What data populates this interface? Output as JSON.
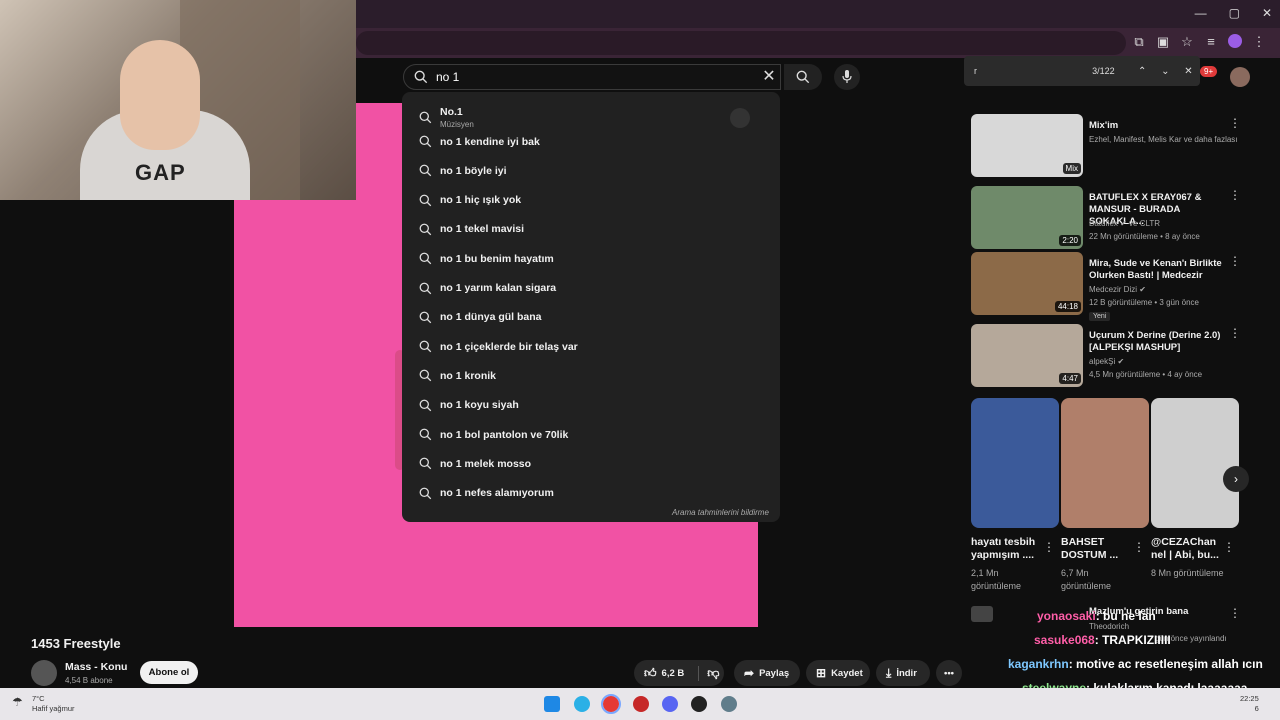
{
  "colors": {
    "accent": "#f152a4",
    "chat_user_1": "#ff5ea8",
    "chat_user_2": "#ff5ea8",
    "chat_user_3": "#7ec8ff",
    "chat_user_4": "#8ee88e"
  },
  "search": {
    "query": "no 1",
    "first_suggestion": {
      "title": "No.1",
      "subtitle": "Müzisyen"
    },
    "suggestions": [
      "no 1 kendine iyi bak",
      "no 1 böyle iyi",
      "no 1 hiç ışık yok",
      "no 1 tekel mavisi",
      "no 1 bu benim hayatım",
      "no 1 yarım kalan sigara",
      "no 1 dünya gül bana",
      "no 1 çiçeklerde bir telaş var",
      "no 1 kronik",
      "no 1 koyu siyah",
      "no 1 bol pantolon ve 70lik",
      "no 1 melek mosso",
      "no 1 nefes alamıyorum"
    ],
    "report_label": "Arama tahminlerini bildirme"
  },
  "findbar": {
    "query": "r",
    "count": "3/122"
  },
  "notifications": "9+",
  "webcam": {
    "shirt_text": "GAP"
  },
  "related": [
    {
      "title": "Mix'im",
      "line1": "Ezhel, Manifest, Melis Kar ve daha fazlası",
      "line2": "",
      "duration": "Mix",
      "thumb": "#d8d8d8"
    },
    {
      "title": "BATUFLEX X ERAY067 & MANSUR - BURADA SOKAKLA...",
      "line1": "Batuflex ✔ ve CLTR",
      "line2": "22 Mn görüntüleme • 8 ay önce",
      "duration": "2:20",
      "thumb": "#6f8a6a"
    },
    {
      "title": "Mira, Sude ve Kenan'ı Birlikte Olurken Bastı! | Medcezir",
      "line1": "Medcezir Dizi ✔",
      "line2": "12 B görüntüleme • 3 gün önce",
      "badge": "Yeni",
      "duration": "44:18",
      "thumb": "#8c6a48"
    },
    {
      "title": "Uçurum X Derine (Derine 2.0) [ALPEKŞI MASHUP]",
      "line1": "alpekŞi ✔",
      "line2": "4,5 Mn görüntüleme • 4 ay önce",
      "duration": "4:47",
      "thumb": "#b5a89a"
    }
  ],
  "shorts": [
    {
      "title": "hayatı tesbih yapmışım ....",
      "views": "2,1 Mn görüntüleme",
      "thumb": "#3b5a9a"
    },
    {
      "title": "BAHSET DOSTUM ...",
      "views": "6,7 Mn görüntüleme",
      "thumb": "#b07f6a"
    },
    {
      "title": "@CEZAChan nel | Abi, bu...",
      "views": "8 Mn görüntüleme",
      "thumb": "#cfcfcf"
    }
  ],
  "next_item": {
    "title": "Mazlum'u getirin bana",
    "channel": "Theodorich",
    "meta": "gün önce yayınlandı"
  },
  "video": {
    "title": "1453 Freestyle",
    "channel": "Mass - Konu",
    "subs": "4,54 B abone",
    "subscribe": "Abone ol",
    "likes": "6,2 B",
    "share": "Paylaş",
    "save": "Kaydet",
    "download": "İndir"
  },
  "chat": [
    {
      "user": "yonaosaki",
      "msg": ": bu ne lan"
    },
    {
      "user": "sasuke068",
      "msg": ": TRAPKIZIIIII"
    },
    {
      "user": "kagankrhn",
      "msg": ": motive ac resetleneşim allah ıcın"
    },
    {
      "user": "steelwayne",
      "msg": ": kulaklarım kanadı laaaaaaa"
    }
  ],
  "taskbar": {
    "temp": "7°C",
    "weather": "Hafif yağmur",
    "time": "22:25",
    "date": "6"
  }
}
